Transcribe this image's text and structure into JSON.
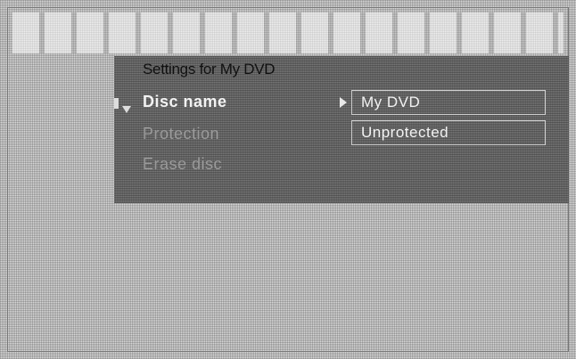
{
  "panel": {
    "title": "Settings for My DVD"
  },
  "menu": {
    "items": [
      {
        "label": "Disc name",
        "state": "selected"
      },
      {
        "label": "Protection",
        "state": "dimmed"
      },
      {
        "label": "Erase disc",
        "state": "dimmed"
      }
    ]
  },
  "values": {
    "disc_name": "My DVD",
    "protection": "Unprotected"
  },
  "icons": {
    "selector": "down-arrow-icon",
    "value_pointer": "right-arrow-icon"
  },
  "colors": {
    "panel": "#686868",
    "background": "#d9d9d9",
    "text_active": "#f2f2f2",
    "text_dimmed": "#9a9a9a"
  }
}
